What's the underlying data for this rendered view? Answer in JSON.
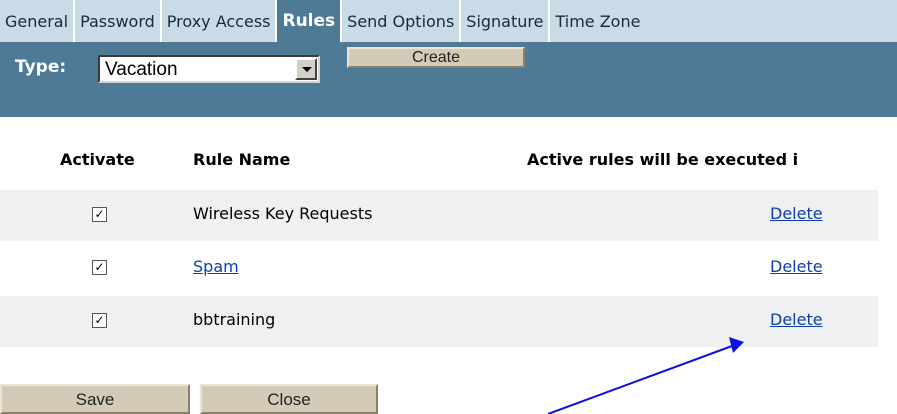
{
  "tabs": [
    {
      "label": "General"
    },
    {
      "label": "Password"
    },
    {
      "label": "Proxy Access"
    },
    {
      "label": "Rules"
    },
    {
      "label": "Send Options"
    },
    {
      "label": "Signature"
    },
    {
      "label": "Time Zone"
    }
  ],
  "active_tab": "Rules",
  "type_bar": {
    "label": "Type:",
    "selected": "Vacation",
    "create_label": "Create"
  },
  "table": {
    "headers": {
      "activate": "Activate",
      "rule_name": "Rule Name",
      "note": "Active rules will be executed i"
    },
    "rows": [
      {
        "checked": true,
        "name": "Wireless Key Requests",
        "link": false,
        "delete_label": "Delete"
      },
      {
        "checked": true,
        "name": "Spam",
        "link": true,
        "delete_label": "Delete"
      },
      {
        "checked": true,
        "name": "bbtraining",
        "link": false,
        "delete_label": "Delete"
      }
    ]
  },
  "buttons": {
    "save": "Save",
    "close": "Close"
  },
  "colors": {
    "tab_bg": "#c8dbe6",
    "accent": "#4e7a96",
    "link": "#0b3fae",
    "annotation_arrow": "#1010e0"
  }
}
